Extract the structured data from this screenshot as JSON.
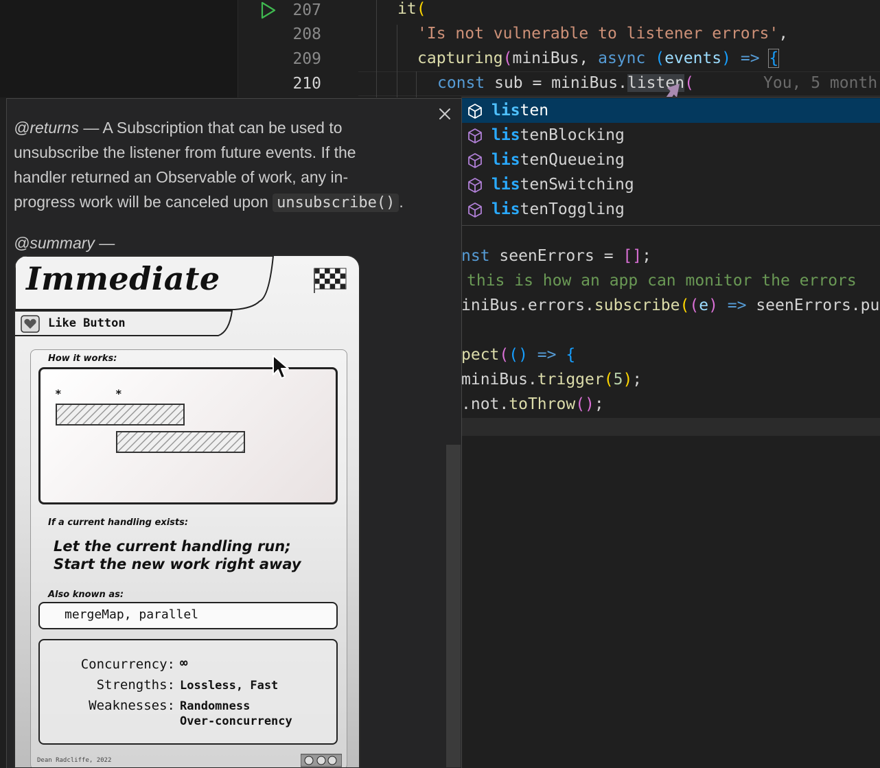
{
  "editor": {
    "line_numbers": [
      "207",
      "208",
      "209",
      "210"
    ],
    "lines": {
      "l207_fn": "it",
      "l207_paren": "(",
      "l208_str": "'Is not vulnerable to listener errors'",
      "l208_comma": ",",
      "l209_fn": "capturing",
      "l209_paren_open": "(",
      "l209_arg": "miniBus, ",
      "l209_async": "async",
      "l209_paren2_open": " (",
      "l209_events": "events",
      "l209_paren2_close": ")",
      "l209_arrow": " => ",
      "l209_brace": "{",
      "l210_const": "const",
      "l210_var": " sub = miniBus.",
      "l210_method": "listen",
      "l210_paren": "(",
      "l210_blame": "You, 5 month",
      "l212_const": "nst",
      "l212_rest": " seenErrors = ",
      "l212_arr": "[]",
      "l212_semi": ";",
      "l213_comment": "this is how an app can monitor the errors",
      "l214_obj": "iniBus.errors.",
      "l214_fn": "subscribe",
      "l214_p1": "(",
      "l214_p2": "(",
      "l214_e": "e",
      "l214_p3": ")",
      "l214_arrow": " => ",
      "l214_rest": "seenErrors.pu",
      "l216_fn": "pect",
      "l216_p1": "(",
      "l216_p2": "()",
      "l216_arrow": " => ",
      "l216_brace": "{",
      "l217_obj": "miniBus.",
      "l217_fn": "trigger",
      "l217_p1": "(",
      "l217_num": "5",
      "l217_p2": ")",
      "l217_semi": ";",
      "l218_rest": ".not.",
      "l218_fn": "toThrow",
      "l218_p": "()",
      "l218_semi": ";"
    }
  },
  "suggestions": [
    {
      "match": "lis",
      "rest": "ten",
      "selected": true
    },
    {
      "match": "lis",
      "rest": "tenBlocking",
      "selected": false
    },
    {
      "match": "lis",
      "rest": "tenQueueing",
      "selected": false
    },
    {
      "match": "lis",
      "rest": "tenSwitching",
      "selected": false
    },
    {
      "match": "lis",
      "rest": "tenToggling",
      "selected": false
    }
  ],
  "docs": {
    "returns_tag": "@returns",
    "returns_line1": " — A Subscription that can be used to",
    "returns_line2": "unsubscribe the listener from future events. If the",
    "returns_line3": "handler returned an Observable of work, any in-",
    "returns_line4": "progress work will be canceled upon ",
    "returns_code": "unsubscribe()",
    "returns_end": ".",
    "summary_tag": "@summary",
    "summary_dash": " —"
  },
  "card": {
    "title": "Immediate",
    "subtitle": "Like Button",
    "how_it_works": "How it works:",
    "if_current": "If a current handling exists:",
    "behavior_line1": "Let the current handling run;",
    "behavior_line2": "Start the new work right away",
    "aka_label": "Also known as:",
    "aka_value": "mergeMap, parallel",
    "stats": [
      {
        "key": "Concurrency:",
        "value": "∞"
      },
      {
        "key": "Strengths:",
        "value": "Lossless, Fast"
      },
      {
        "key": "Weaknesses:",
        "value": "Randomness"
      },
      {
        "key": "",
        "value": "Over-concurrency"
      }
    ],
    "credit": "Dean Radcliffe, 2022"
  },
  "colors": {
    "selection_bg": "#04395e",
    "match": "#4fc1ff",
    "editor_bg": "#1f1f1f",
    "hover_bg": "#252526"
  }
}
